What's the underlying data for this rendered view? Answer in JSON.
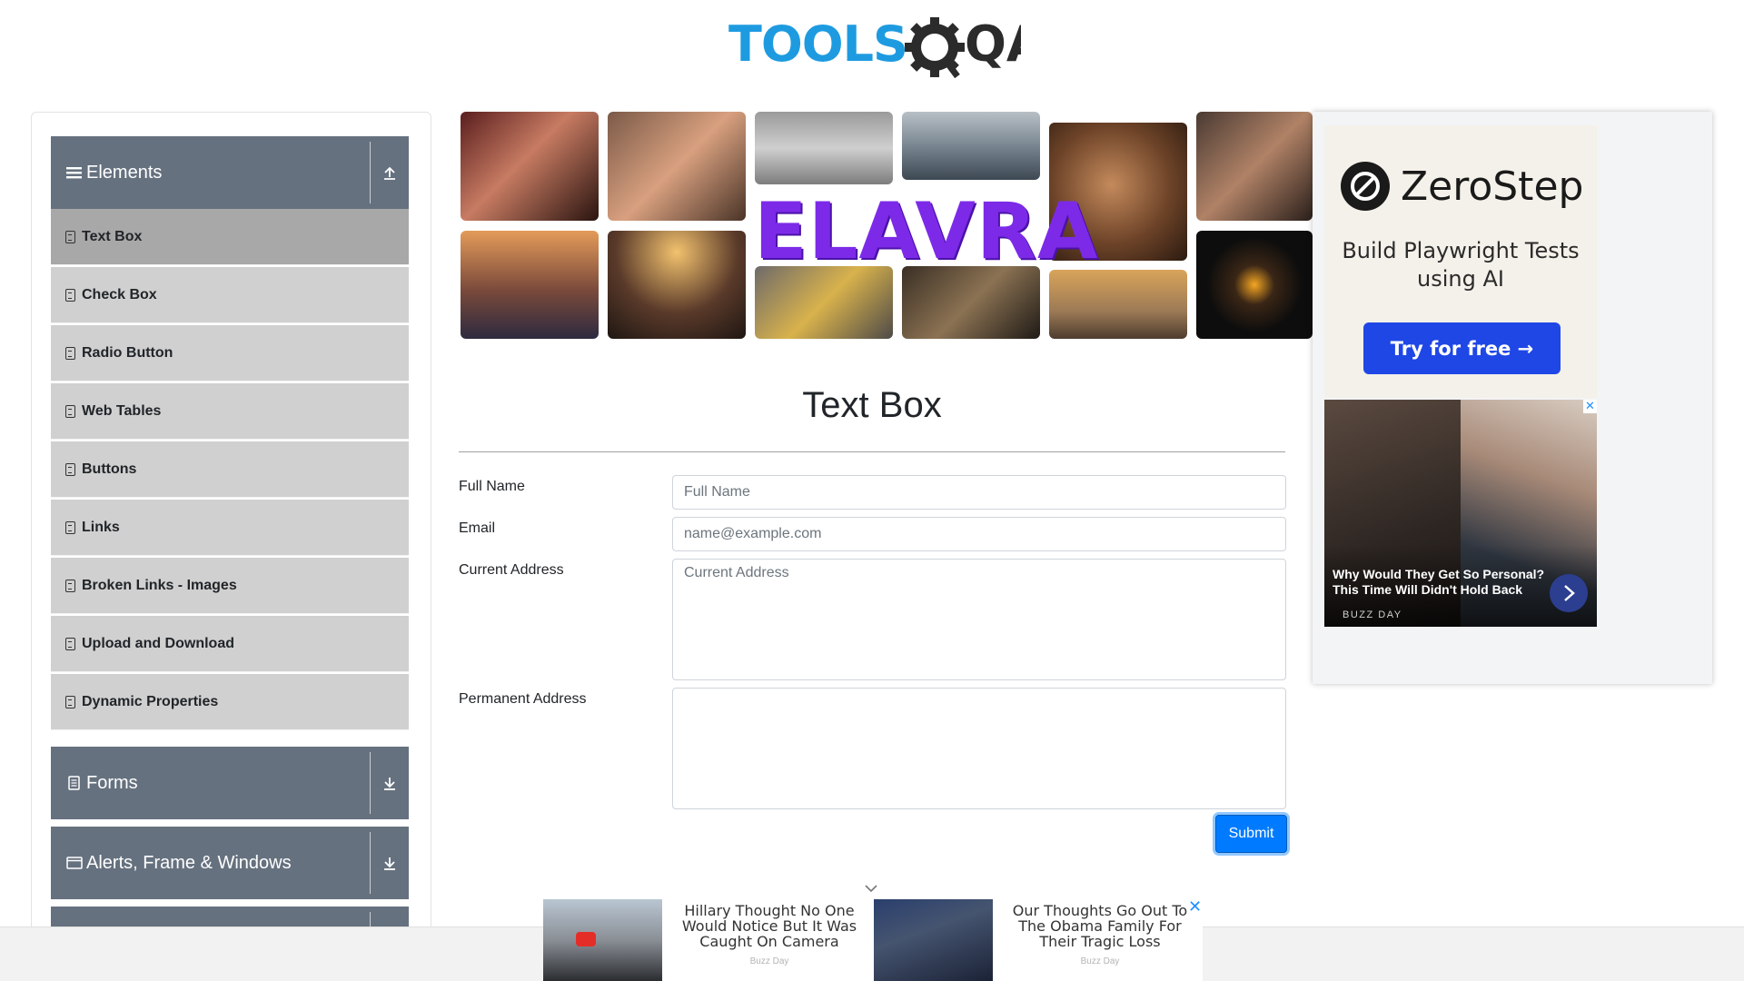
{
  "header": {
    "logo_text_left": "TOOLS",
    "logo_text_right": "QA"
  },
  "sidebar": {
    "groups": [
      {
        "label": "Elements",
        "icon": "hamburger-icon",
        "toggle_icon": "collapse-arrow-icon"
      },
      {
        "label": "Forms",
        "icon": "document-icon",
        "toggle_icon": "expand-arrow-icon"
      },
      {
        "label": "Alerts, Frame & Windows",
        "icon": "window-icon",
        "toggle_icon": "expand-arrow-icon"
      }
    ],
    "items": [
      {
        "label": "Text Box",
        "active": true
      },
      {
        "label": "Check Box"
      },
      {
        "label": "Radio Button"
      },
      {
        "label": "Web Tables"
      },
      {
        "label": "Buttons"
      },
      {
        "label": "Links"
      },
      {
        "label": "Broken Links - Images"
      },
      {
        "label": "Upload and Download"
      },
      {
        "label": "Dynamic Properties"
      }
    ]
  },
  "banner": {
    "brand": "ELAVRA"
  },
  "form": {
    "title": "Text Box",
    "fields": {
      "full_name": {
        "label": "Full Name",
        "placeholder": "Full Name",
        "value": ""
      },
      "email": {
        "label": "Email",
        "placeholder": "name@example.com",
        "value": ""
      },
      "current_address": {
        "label": "Current Address",
        "placeholder": "Current Address",
        "value": ""
      },
      "permanent_address": {
        "label": "Permanent Address",
        "placeholder": "",
        "value": ""
      }
    },
    "submit_label": "Submit"
  },
  "side_ad": {
    "brand": "ZeroStep",
    "tagline": "Build Playwright Tests using AI",
    "cta": "Try for free →",
    "news_headline": "Why Would They Get So Personal? This Time Will Didn't Hold Back",
    "news_source": "BUZZ DAY",
    "close_icon": "close-icon"
  },
  "bottom_ads": [
    {
      "title": "Hillary Thought No One Would Notice But It Was Caught On Camera",
      "source": "Buzz Day"
    },
    {
      "title": "Our Thoughts Go Out To The Obama Family For Their Tragic Loss",
      "source": "Buzz Day"
    }
  ],
  "colors": {
    "accent": "#007bff",
    "sidebar_header": "#66717f",
    "sidebar_item": "#d0d0d0",
    "sidebar_item_active": "#a8a8a8",
    "brand_blue": "#1e9be0",
    "brand_dark": "#2b2b2b"
  }
}
